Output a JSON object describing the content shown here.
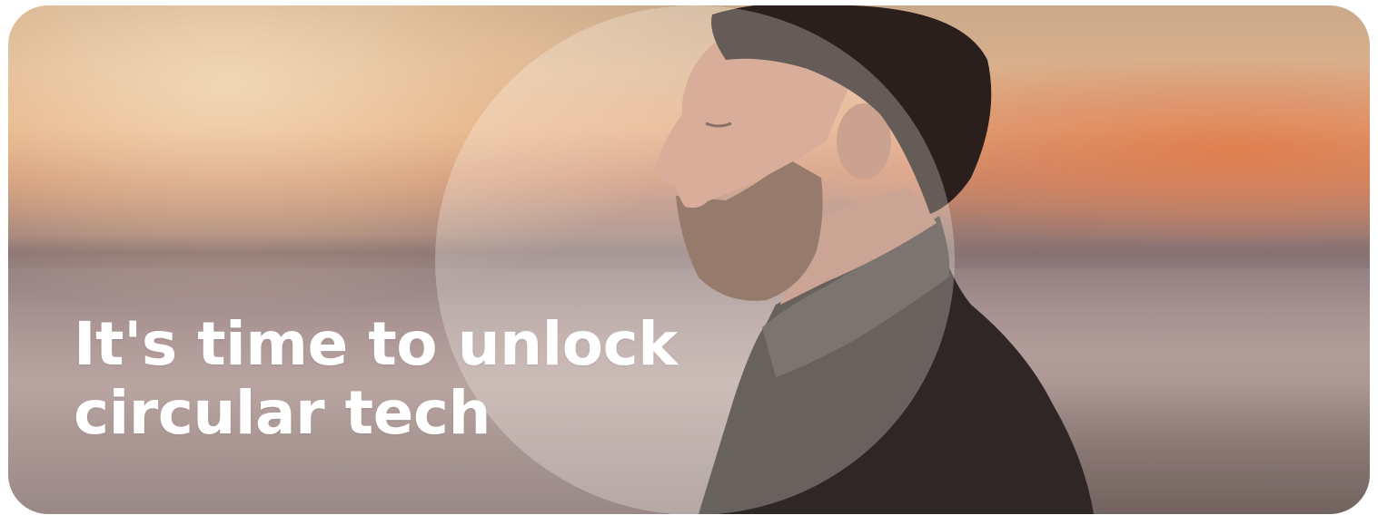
{
  "hero": {
    "headline_line1": "It's time to unlock",
    "headline_line2": "circular tech"
  },
  "colors": {
    "headline": "#ffffff",
    "sunset_orange": "#e2784a",
    "sky_light": "#f5debe",
    "jacket": "#2e2726",
    "hair": "#2a1f1c",
    "skin": "#c98f78"
  },
  "image": {
    "subject_icon": "man-profile-illustration"
  }
}
